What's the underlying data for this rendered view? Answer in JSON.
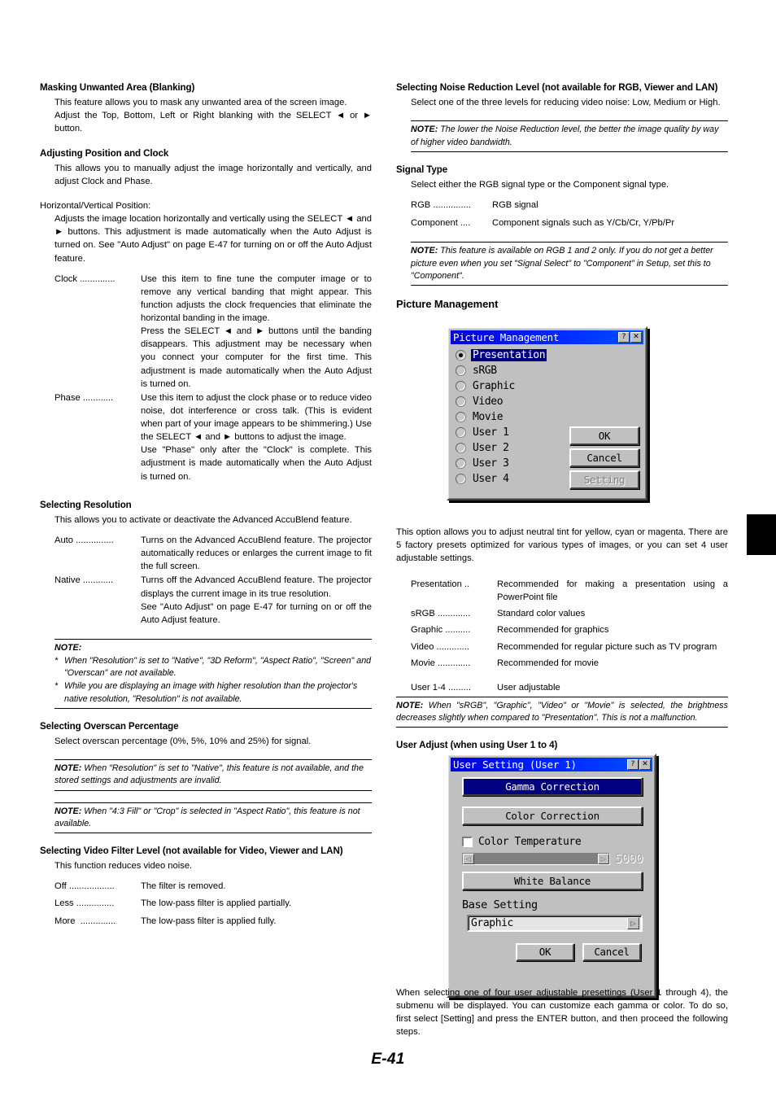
{
  "page": {
    "number_label": "E-41"
  },
  "left_column": {
    "s1": {
      "heading": "Masking Unwanted Area (Blanking)",
      "p1": "This feature allows you to mask any unwanted area of the screen image.",
      "p2": "Adjust the Top, Bottom, Left or Right blanking with the SELECT ◄ or ► button."
    },
    "s2": {
      "heading": "Adjusting Position and Clock",
      "p1": "This allows you to manually adjust the image horizontally and vertically, and adjust Clock and Phase."
    },
    "s3": {
      "heading": "Horizontal/Vertical Position:",
      "p1": "Adjusts the image location horizontally and vertically using the SELECT ◄ and ► buttons. This adjustment is made automatically when the Auto Adjust is turned on. See \"Auto Adjust\" on page E-47 for turning on or off the Auto Adjust feature.",
      "items": [
        {
          "term": "Clock ..............",
          "desc": "Use this item to fine tune the computer image or to remove any vertical banding that might appear. This function adjusts the clock frequencies that eliminate the horizontal banding in the image.\nPress the SELECT ◄ and ► buttons until the banding disappears. This adjustment may be necessary when you connect your computer for the first time. This adjustment is made automatically when the Auto Adjust is turned on."
        },
        {
          "term": "Phase ............",
          "desc": "Use this item to adjust the clock phase or to reduce video noise, dot interference or cross talk. (This is evident when part of your image appears to be shimmering.) Use the SELECT ◄ and ► buttons to adjust the image.\nUse \"Phase\" only after the \"Clock\" is complete. This adjustment is made automatically when the Auto Adjust is turned on."
        }
      ]
    },
    "s4": {
      "heading": "Selecting Resolution",
      "p1": "This allows you to activate or deactivate the Advanced AccuBlend feature.",
      "items": [
        {
          "term": "Auto ...............",
          "desc": "Turns on the Advanced AccuBlend feature. The projector automatically reduces or enlarges the current image to fit the full screen."
        },
        {
          "term": "Native ............",
          "desc": "Turns off the Advanced AccuBlend feature. The projector displays the current image in its true resolution.\nSee \"Auto Adjust\" on page E-47 for turning on or off the Auto Adjust feature."
        }
      ],
      "note_title": "NOTE:",
      "note_items": [
        "When \"Resolution\" is set to \"Native\", \"3D Reform\", \"Aspect Ratio\", \"Screen\" and \"Overscan\" are not available.",
        "While you are displaying an image with higher resolution than the projector's native resolution, \"Resolution\" is not available."
      ]
    },
    "s5": {
      "heading": "Selecting Overscan Percentage",
      "p1": "Select overscan percentage (0%, 5%, 10% and 25%) for signal.",
      "note1_label": "NOTE:",
      "note1_text": "When \"Resolution\" is set to \"Native\", this feature is not available, and the stored settings and adjustments are invalid.",
      "note2_label": "NOTE:",
      "note2_text": "When \"4:3 Fill\" or \"Crop\" is selected in \"Aspect Ratio\", this feature is not available."
    },
    "s6": {
      "heading": "Selecting Video Filter Level (not available for Video, Viewer and LAN)",
      "p1": "This function reduces video noise.",
      "items": [
        {
          "term": "Off ..................",
          "desc": "The filter is removed."
        },
        {
          "term": "Less ...............",
          "desc": "The low-pass filter is applied partially."
        },
        {
          "term": "More  ..............",
          "desc": "The low-pass filter is applied fully."
        }
      ]
    }
  },
  "right_column": {
    "s1": {
      "heading": "Selecting Noise Reduction Level (not available for RGB, Viewer and LAN)",
      "p1": "Select one of the three levels for reducing video noise: Low, Medium or High.",
      "note_label": "NOTE:",
      "note_text": "The lower the Noise Reduction level, the better the image quality by way of higher video bandwidth."
    },
    "s2": {
      "heading": "Signal Type",
      "p1": "Select either the RGB signal type or the Component signal type.",
      "items": [
        {
          "term": "RGB ...............",
          "desc": "RGB signal"
        },
        {
          "term": "Component ....",
          "desc": "Component signals such as Y/Cb/Cr, Y/Pb/Pr"
        }
      ],
      "note_label": "NOTE:",
      "note_text": "This feature is available on RGB 1 and 2 only. If you do not get a better picture even when you set \"Signal Select\" to \"Component\" in Setup, set this to \"Component\"."
    },
    "s3": {
      "heading": "Picture Management",
      "caption": "This option allows you to adjust neutral tint for yellow, cyan or magenta. There are 5 factory presets optimized for various types of images, or you can set 4 user adjustable settings.",
      "items": [
        {
          "term": "Presentation ..",
          "desc": "Recommended for making a presentation using a PowerPoint file"
        },
        {
          "term": "sRGB .............",
          "desc": "Standard color values"
        },
        {
          "term": "Graphic ..........",
          "desc": "Recommended for graphics"
        },
        {
          "term": "Video .............",
          "desc": "Recommended for regular picture such as TV program"
        },
        {
          "term": "Movie .............",
          "desc": "Recommended for movie"
        },
        {
          "term": "User 1-4 .........",
          "desc": "User adjustable"
        }
      ],
      "note_label": "NOTE:",
      "note_text": "When \"sRGB\", \"Graphic\", \"Video\" or \"Movie\" is selected, the brightness decreases slightly when compared to \"Presentation\". This is not a malfunction."
    },
    "s4": {
      "heading": "User Adjust (when using User 1 to 4)",
      "caption": "When selecting one of four user adjustable presettings (User 1 through 4), the submenu will be displayed.\nYou can customize each gamma or color. To do so, first select [Setting] and press the ENTER button, and then proceed the following steps."
    }
  },
  "picture_management_dialog": {
    "title": "Picture Management",
    "help_button": "?",
    "close_button": "✕",
    "options": [
      {
        "label": "Presentation",
        "selected": true
      },
      {
        "label": "sRGB",
        "selected": false
      },
      {
        "label": "Graphic",
        "selected": false
      },
      {
        "label": "Video",
        "selected": false
      },
      {
        "label": "Movie",
        "selected": false
      },
      {
        "label": "User 1",
        "selected": false
      },
      {
        "label": "User 2",
        "selected": false
      },
      {
        "label": "User 3",
        "selected": false
      },
      {
        "label": "User 4",
        "selected": false
      }
    ],
    "buttons": {
      "ok": "OK",
      "cancel": "Cancel",
      "setting": "Setting"
    },
    "colors": {
      "titlebar": "#0000d8",
      "selection": "#000080",
      "face": "#c0c0c0"
    }
  },
  "user_setting_dialog": {
    "title": "User Setting (User 1)",
    "help_button": "?",
    "close_button": "✕",
    "gamma_correction_label": "Gamma Correction",
    "color_correction_label": "Color Correction",
    "color_temperature_label": "Color Temperature",
    "color_temperature_value": "5000",
    "slider_left_arrow": "◁",
    "slider_right_arrow": "▷",
    "white_balance_label": "White Balance",
    "base_setting_label": "Base Setting",
    "base_setting_value": "Graphic",
    "base_setting_arrow": "▷",
    "buttons": {
      "ok": "OK",
      "cancel": "Cancel"
    },
    "colors": {
      "titlebar": "#0000d8",
      "highlight": "#000080",
      "face": "#c0c0c0"
    }
  }
}
